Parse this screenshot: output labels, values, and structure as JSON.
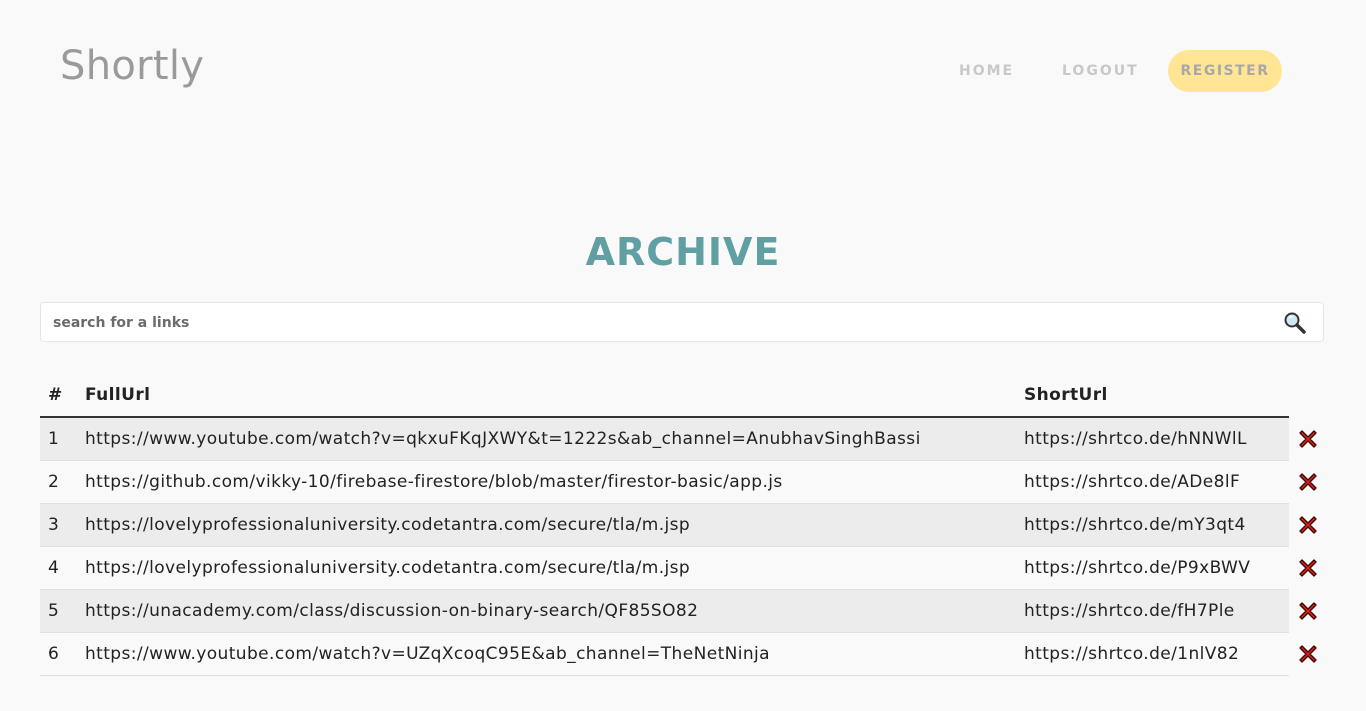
{
  "brand": {
    "name": "Shortly"
  },
  "nav": {
    "home": "HOME",
    "logout": "LOGOUT",
    "register": "REGISTER"
  },
  "page": {
    "title": "ARCHIVE"
  },
  "search": {
    "placeholder": "search for a links",
    "value": "",
    "icon": "search-icon"
  },
  "table": {
    "headers": {
      "num": "#",
      "full": "FullUrl",
      "short": "ShortUrl"
    },
    "rows": [
      {
        "num": "1",
        "full": "https://www.youtube.com/watch?v=qkxuFKqJXWY&t=1222s&ab_channel=AnubhavSinghBassi",
        "short": "https://shrtco.de/hNNWlL"
      },
      {
        "num": "2",
        "full": "https://github.com/vikky-10/firebase-firestore/blob/master/firestor-basic/app.js",
        "short": "https://shrtco.de/ADe8lF"
      },
      {
        "num": "3",
        "full": "https://lovelyprofessionaluniversity.codetantra.com/secure/tla/m.jsp",
        "short": "https://shrtco.de/mY3qt4"
      },
      {
        "num": "4",
        "full": "https://lovelyprofessionaluniversity.codetantra.com/secure/tla/m.jsp",
        "short": "https://shrtco.de/P9xBWV"
      },
      {
        "num": "5",
        "full": "https://unacademy.com/class/discussion-on-binary-search/QF85SO82",
        "short": "https://shrtco.de/fH7Ple"
      },
      {
        "num": "6",
        "full": "https://www.youtube.com/watch?v=UZqXcoqC95E&ab_channel=TheNetNinja",
        "short": "https://shrtco.de/1nlV82"
      }
    ],
    "delete_icon": "close-icon"
  },
  "colors": {
    "accent": "#609fa2",
    "register_bg": "#ffe594",
    "delete": "#e0201a"
  }
}
